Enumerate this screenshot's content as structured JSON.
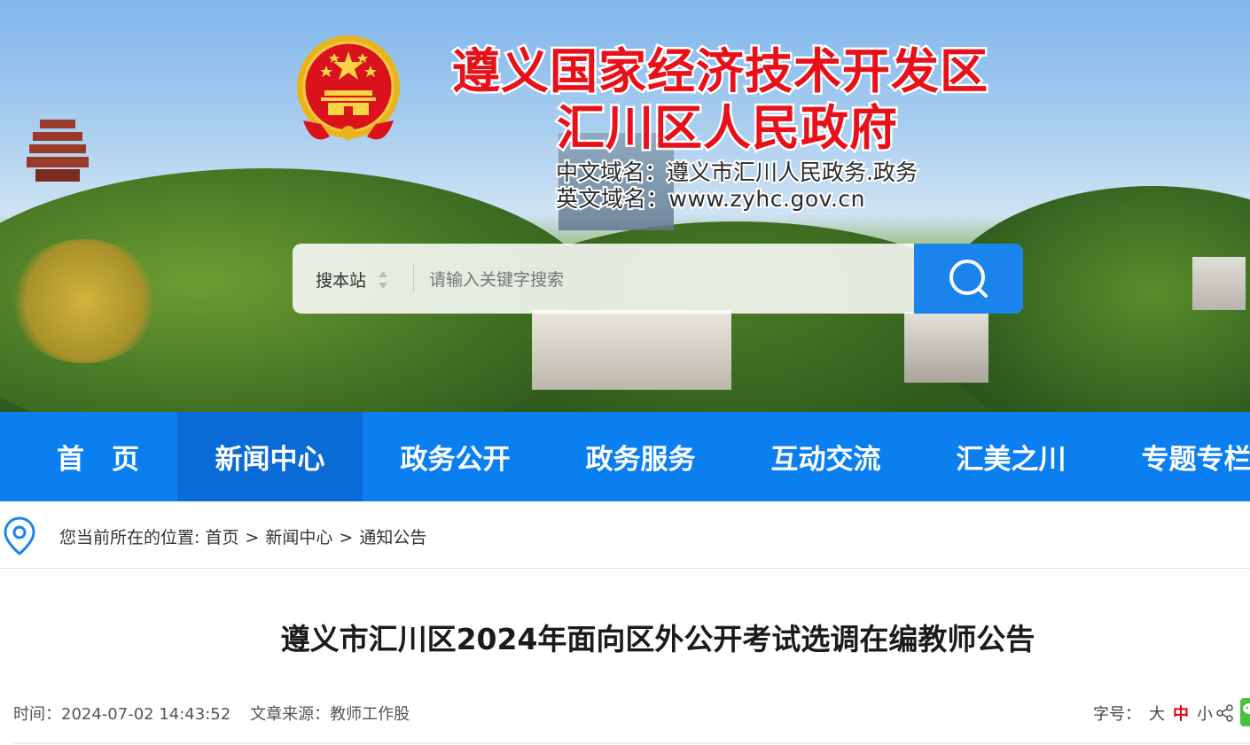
{
  "header": {
    "title_line1": "遵义国家经济技术开发区",
    "title_line2": "汇川区人民政府",
    "domain_cn": "中文域名：遵义市汇川人民政务.政务",
    "domain_en": "英文域名：www.zyhc.gov.cn",
    "title_color": "#e8111a"
  },
  "search": {
    "scope_label": "搜本站",
    "placeholder": "请输入关键字搜索",
    "button_icon": "search-icon",
    "button_color": "#1b83ec"
  },
  "nav": {
    "color": "#0c7ff0",
    "items": [
      {
        "label": "首　页"
      },
      {
        "label": "新闻中心"
      },
      {
        "label": "政务公开"
      },
      {
        "label": "政务服务"
      },
      {
        "label": "互动交流"
      },
      {
        "label": "汇美之川"
      },
      {
        "label": "专题专栏"
      }
    ],
    "active_label": "新闻中心"
  },
  "breadcrumb": {
    "prefix": "您当前所在的位置:",
    "items": [
      "首页",
      "新闻中心",
      "通知公告"
    ],
    "separator": ">"
  },
  "article": {
    "title": "遵义市汇川区2024年面向区外公开考试选调在编教师公告",
    "time": "时间：2024-07-02 14:43:52",
    "source": "文章来源：教师工作股",
    "font_size_label": "字号：",
    "font_options": [
      "大",
      "中",
      "小"
    ],
    "selected_font": "中"
  }
}
